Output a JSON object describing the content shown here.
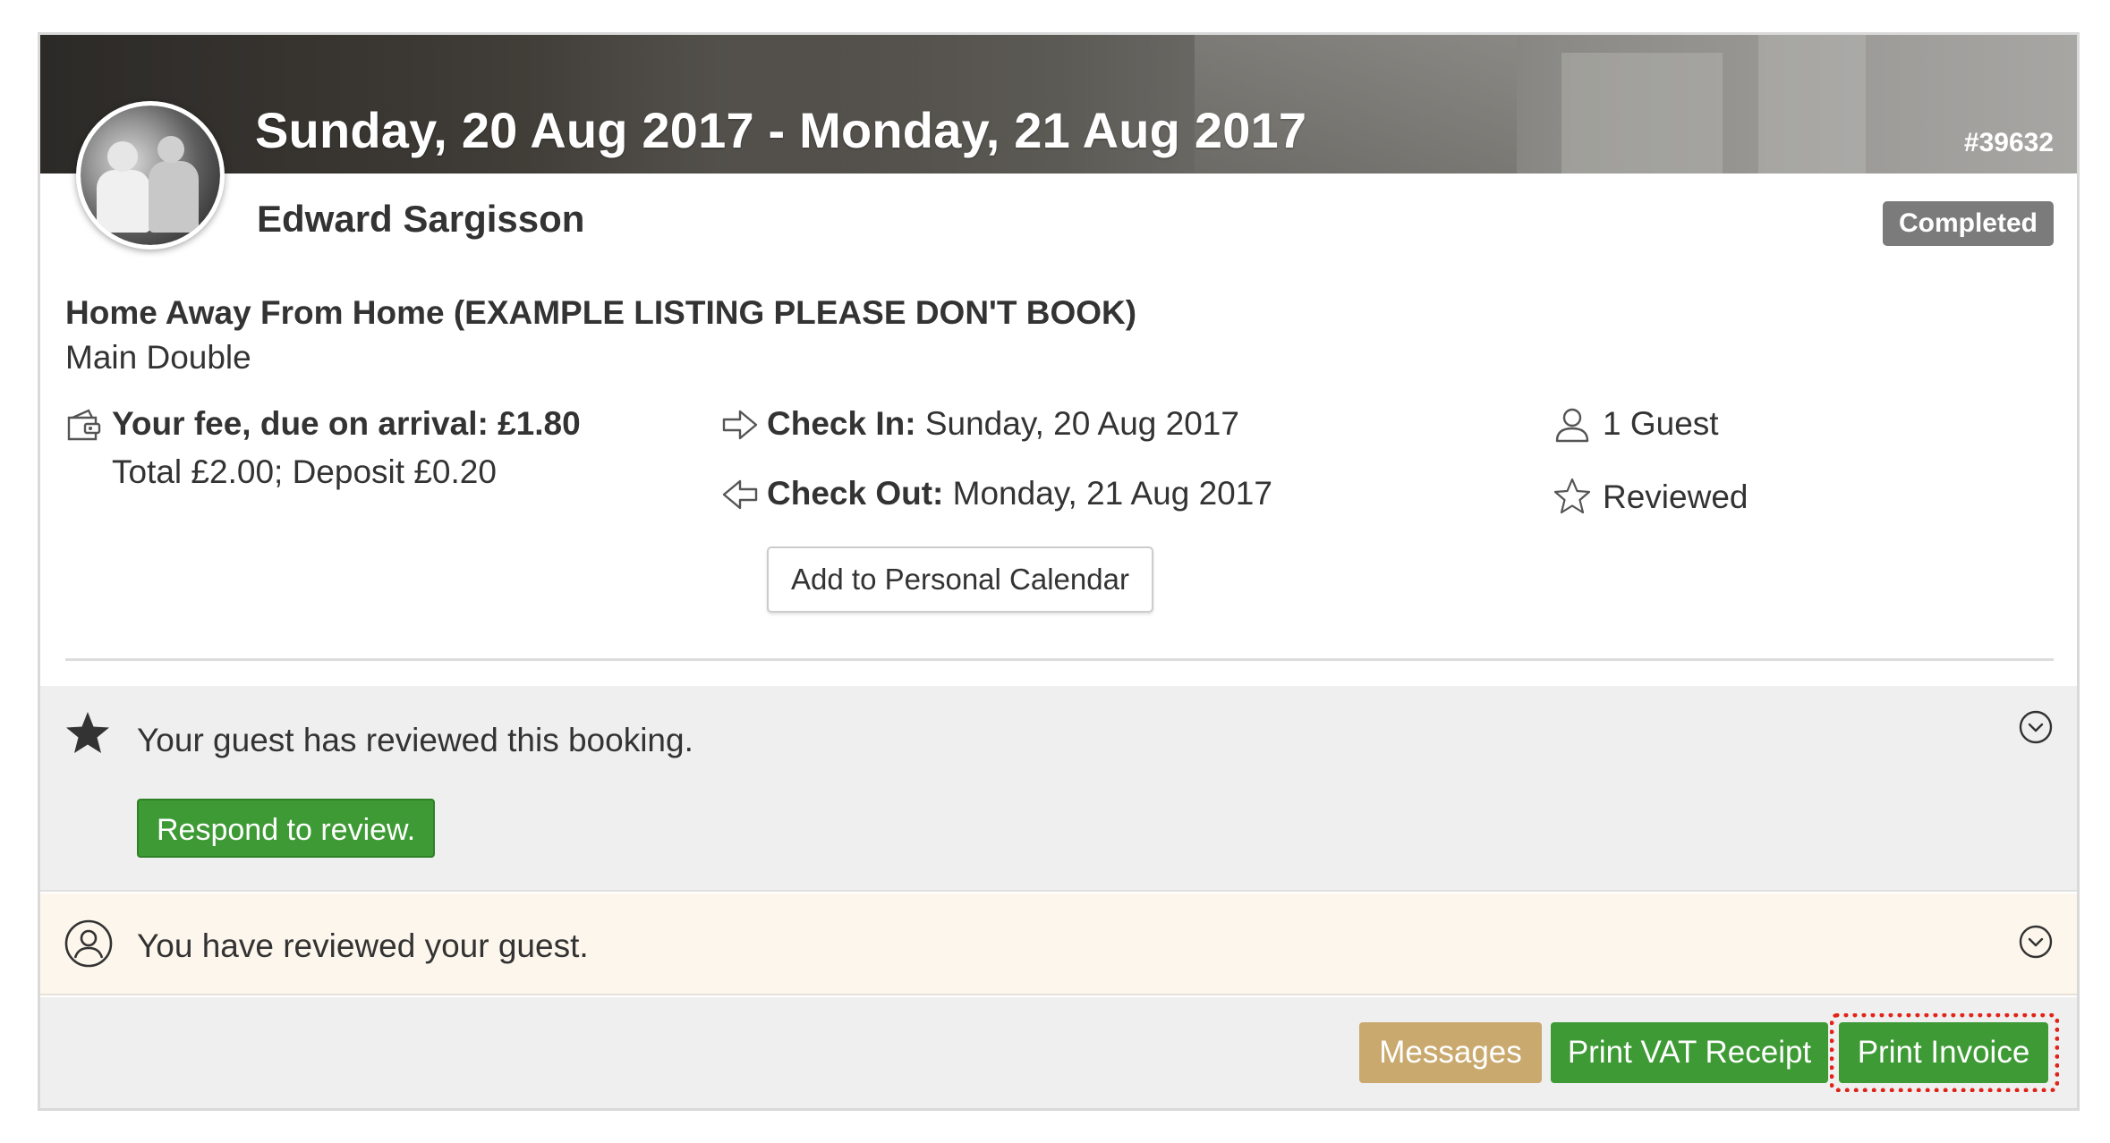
{
  "header": {
    "date_range": "Sunday, 20 Aug 2017 - Monday, 21 Aug 2017",
    "booking_id": "#39632",
    "guest_name": "Edward Sargisson",
    "status": "Completed"
  },
  "listing": {
    "title": "Home Away From Home (EXAMPLE LISTING PLEASE DON'T BOOK)",
    "room": "Main Double"
  },
  "fees": {
    "fee_label": "Your fee, due on arrival: £1.80",
    "totals": "Total £2.00; Deposit £0.20"
  },
  "dates": {
    "checkin_label": "Check In:",
    "checkin_value": "Sunday, 20 Aug 2017",
    "checkout_label": "Check Out:",
    "checkout_value": "Monday, 21 Aug 2017",
    "calendar_button": "Add to Personal Calendar"
  },
  "summary": {
    "guests": "1 Guest",
    "review_state": "Reviewed"
  },
  "review_panel": {
    "text": "Your guest has reviewed this booking.",
    "respond_button": "Respond to review."
  },
  "guest_review_panel": {
    "text": "You have reviewed your guest."
  },
  "footer": {
    "messages_button": "Messages",
    "vat_button": "Print VAT Receipt",
    "invoice_button": "Print Invoice"
  },
  "colors": {
    "green": "#3d9a34",
    "gold": "#c9a96e",
    "badge_gray": "#7b7b7b",
    "highlight_red": "#e2231a"
  }
}
